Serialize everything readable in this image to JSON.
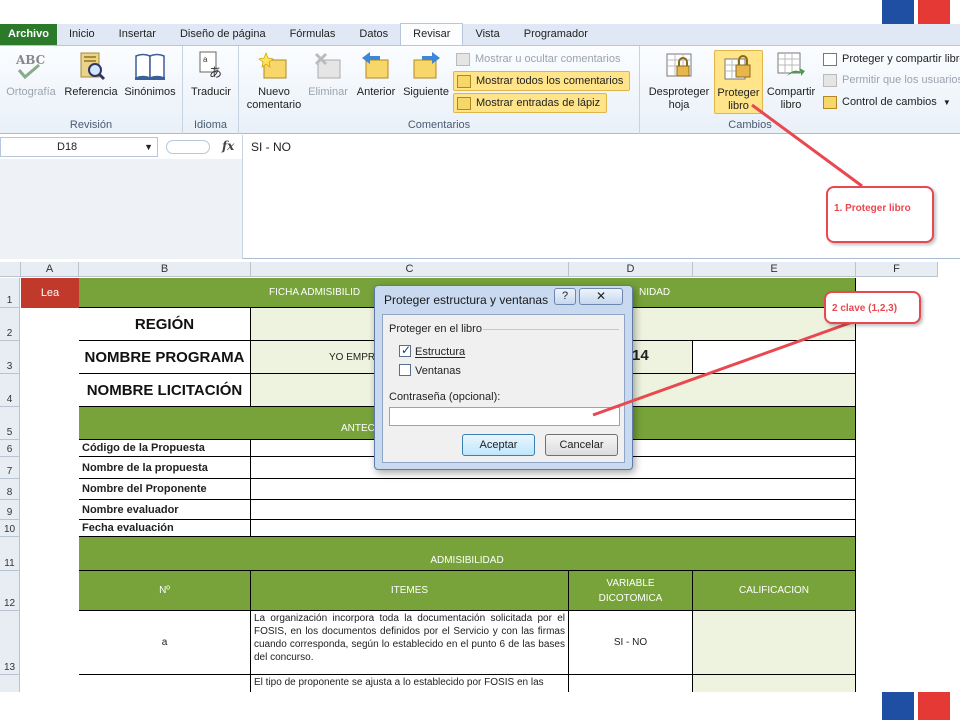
{
  "tabs": [
    {
      "label": "Archivo"
    },
    {
      "label": "Inicio"
    },
    {
      "label": "Insertar"
    },
    {
      "label": "Diseño de página"
    },
    {
      "label": "Fórmulas"
    },
    {
      "label": "Datos"
    },
    {
      "label": "Revisar"
    },
    {
      "label": "Vista"
    },
    {
      "label": "Programador"
    }
  ],
  "ribbon": {
    "revision": {
      "label": "Revisión",
      "ortografia": "Ortografía",
      "referencia": "Referencia",
      "sinonimos": "Sinónimos"
    },
    "idioma": {
      "label": "Idioma",
      "traducir": "Traducir"
    },
    "comentarios": {
      "label": "Comentarios",
      "nuevo_1": "Nuevo",
      "nuevo_2": "comentario",
      "eliminar": "Eliminar",
      "anterior": "Anterior",
      "siguiente": "Siguiente",
      "mostrar_ocultar": "Mostrar u ocultar comentarios",
      "mostrar_todos": "Mostrar todos los comentarios",
      "mostrar_entradas": "Mostrar entradas de lápiz"
    },
    "cambios": {
      "label": "Cambios",
      "desproteger_1": "Desproteger",
      "desproteger_2": "hoja",
      "proteger_1": "Proteger",
      "proteger_2": "libro",
      "compartir_1": "Compartir",
      "compartir_2": "libro",
      "proteger_compartir": "Proteger y compartir libro",
      "permitir": "Permitir que los usuarios",
      "control": "Control de cambios"
    }
  },
  "formula_bar": {
    "cell_ref": "D18",
    "value": "SI - NO"
  },
  "columns": [
    "A",
    "B",
    "C",
    "D",
    "E",
    "F"
  ],
  "rows": [
    "1",
    "2",
    "3",
    "4",
    "5",
    "6",
    "7",
    "8",
    "9",
    "10",
    "11",
    "12",
    "13"
  ],
  "sheet": {
    "a1": "Lea",
    "header_left": "FICHA ADMISIBILID",
    "header_right": "NIDAD",
    "region": "REGIÓN",
    "nombre_programa": "NOMBRE PROGRAMA",
    "programa_value_left": "YO EMPR",
    "programa_value_right": "14",
    "nombre_licitacion": "NOMBRE LICITACIÓN",
    "antec": "ANTEC",
    "codigo": "Código de la Propuesta",
    "nombre_propuesta": "Nombre de la propuesta",
    "nombre_proponente": "Nombre del Proponente",
    "nombre_evaluador": "Nombre evaluador",
    "fecha": "Fecha evaluación",
    "admisibilidad": "ADMISIBILIDAD",
    "col_n": "Nº",
    "col_itemes": "ITEMES",
    "col_variable": "VARIABLE DICOTOMICA",
    "col_calificacion": "CALIFICACION",
    "row13_n": "a",
    "row13_text": "La organización incorpora toda la documentación solicitada por el FOSIS, en los documentos definidos por el Servicio y con las firmas cuando corresponda, según lo establecido en el punto 6 de las bases del concurso.",
    "row13_var": "SI - NO",
    "row14_text": "El tipo de proponente se ajusta a lo establecido por FOSIS en las"
  },
  "dialog": {
    "title": "Proteger estructura y ventanas",
    "help": "?",
    "close": "✕",
    "group": "Proteger en el libro",
    "estructura": "Estructura",
    "estructura_checked": true,
    "ventanas": "Ventanas",
    "ventanas_checked": false,
    "password_label": "Contraseña (opcional):",
    "password_value": "",
    "ok": "Aceptar",
    "cancel": "Cancelar"
  },
  "callouts": {
    "one": "1. Proteger libro",
    "two": "2 clave (1,2,3)"
  },
  "colors": {
    "green": "#77a33a",
    "callout_red": "#e8484f",
    "file_tab": "#2a7a2a"
  }
}
